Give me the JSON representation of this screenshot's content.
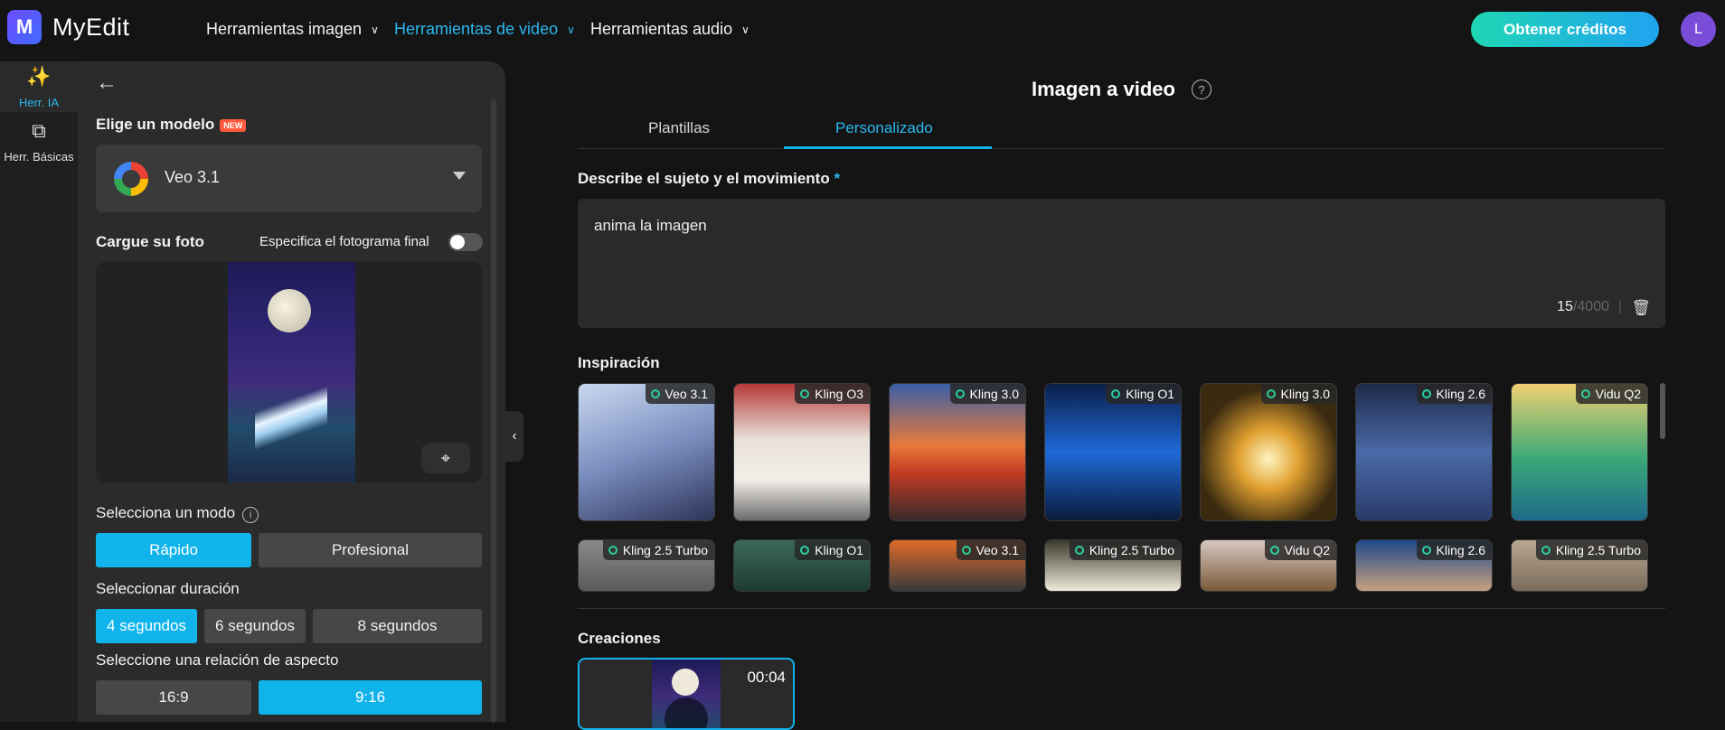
{
  "app": {
    "name": "MyEdit",
    "logo_letter": "M"
  },
  "nav": {
    "image_tools": "Herramientas imagen",
    "video_tools": "Herramientas de video",
    "audio_tools": "Herramientas audio"
  },
  "header": {
    "credits_button": "Obtener créditos",
    "avatar_letter": "L"
  },
  "rail": {
    "ai_tools": "Herr. IA",
    "basic_tools": "Herr. Básicas"
  },
  "panel": {
    "model_label": "Elige un modelo",
    "new_badge": "NEW",
    "model_value": "Veo 3.1",
    "upload_label": "Cargue su foto",
    "end_frame_label": "Especifica el fotograma final",
    "end_frame_enabled": false,
    "mode_label": "Selecciona un modo",
    "modes": [
      "Rápido",
      "Profesional"
    ],
    "mode_selected": "Rápido",
    "duration_label": "Seleccionar duración",
    "durations": [
      "4 segundos",
      "6 segundos",
      "8 segundos"
    ],
    "duration_selected": "4 segundos",
    "aspect_label": "Seleccione una relación de aspecto",
    "aspects": [
      "16:9",
      "9:16"
    ],
    "aspect_selected": "9:16"
  },
  "main": {
    "title": "Imagen a video",
    "tabs": [
      "Plantillas",
      "Personalizado"
    ],
    "active_tab": "Personalizado",
    "describe_label": "Describe el sujeto y el movimiento",
    "required_mark": "*",
    "prompt_text": "anima la imagen",
    "char_count": "15",
    "char_max": "/4000",
    "separator": "|",
    "inspiration_label": "Inspiración",
    "inspiration": [
      {
        "model": "Veo 3.1"
      },
      {
        "model": "Kling O3"
      },
      {
        "model": "Kling 3.0"
      },
      {
        "model": "Kling O1"
      },
      {
        "model": "Kling 3.0"
      },
      {
        "model": "Kling 2.6"
      },
      {
        "model": "Vidu Q2"
      },
      {
        "model": "Kling 2.5 Turbo"
      },
      {
        "model": "Kling O1"
      },
      {
        "model": "Veo 3.1"
      },
      {
        "model": "Kling 2.5 Turbo"
      },
      {
        "model": "Vidu Q2"
      },
      {
        "model": "Kling 2.6"
      },
      {
        "model": "Kling 2.5 Turbo"
      }
    ],
    "creations_label": "Creaciones",
    "creation_duration": "00:04"
  },
  "colors": {
    "accent": "#10b4ea",
    "active_nav": "#2bb8f0",
    "new_badge": "#ff5a3c"
  }
}
